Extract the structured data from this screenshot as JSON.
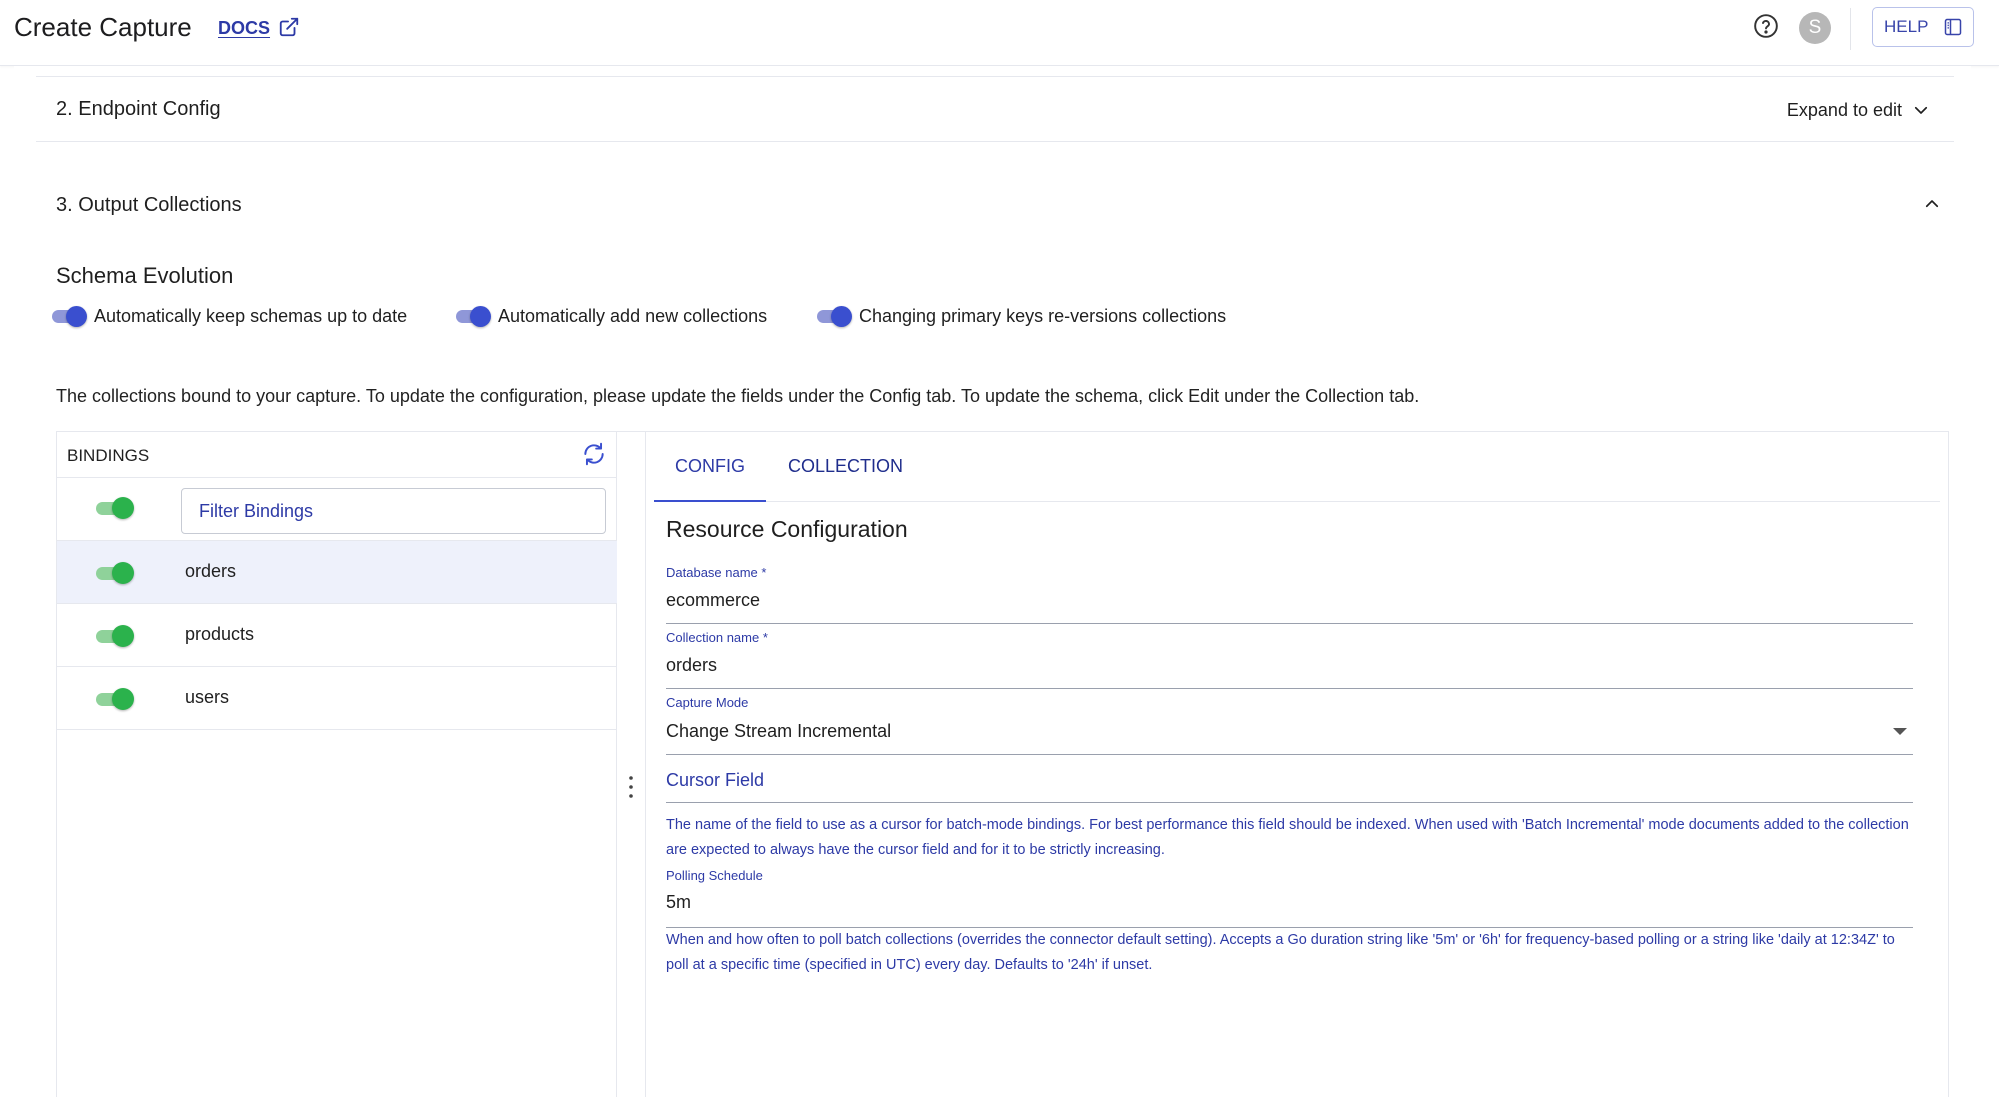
{
  "header": {
    "title": "Create Capture",
    "docs_label": "DOCS",
    "avatar_initial": "S",
    "help_label": "HELP"
  },
  "sections": {
    "endpoint": {
      "title": "2. Endpoint Config",
      "action": "Expand to edit"
    },
    "output": {
      "title": "3. Output Collections"
    }
  },
  "schema_evolution": {
    "heading": "Schema Evolution",
    "toggles": [
      {
        "label": "Automatically keep schemas up to date",
        "on": true
      },
      {
        "label": "Automatically add new collections",
        "on": true
      },
      {
        "label": "Changing primary keys re-versions collections",
        "on": true
      }
    ]
  },
  "description": "The collections bound to your capture. To update the configuration, please update the fields under the Config tab. To update the schema, click Edit under the Collection tab.",
  "bindings": {
    "header": "BINDINGS",
    "filter_placeholder": "Filter Bindings",
    "items": [
      {
        "name": "orders",
        "enabled": true,
        "selected": true
      },
      {
        "name": "products",
        "enabled": true,
        "selected": false
      },
      {
        "name": "users",
        "enabled": true,
        "selected": false
      }
    ]
  },
  "tabs": {
    "config": "CONFIG",
    "collection": "COLLECTION"
  },
  "resource": {
    "title": "Resource Configuration",
    "database_label": "Database name *",
    "database_value": "ecommerce",
    "collection_label": "Collection name *",
    "collection_value": "orders",
    "mode_label": "Capture Mode",
    "mode_value": "Change Stream Incremental",
    "cursor_placeholder": "Cursor Field",
    "cursor_help": "The name of the field to use as a cursor for batch-mode bindings. For best performance this field should be indexed. When used with 'Batch Incremental' mode documents added to the collection are expected to always have the cursor field and for it to be strictly increasing.",
    "polling_label": "Polling Schedule",
    "polling_value": "5m",
    "polling_help": "When and how often to poll batch collections (overrides the connector default setting). Accepts a Go duration string like '5m' or '6h' for frequency-based polling or a string like 'daily at 12:34Z' to poll at a specific time (specified in UTC) every day. Defaults to '24h' if unset."
  },
  "colors": {
    "accent": "#2d3aa6",
    "toggle_blue": "#3a4fcf",
    "toggle_green": "#2bb24c",
    "selected_row": "#eef1fb"
  }
}
